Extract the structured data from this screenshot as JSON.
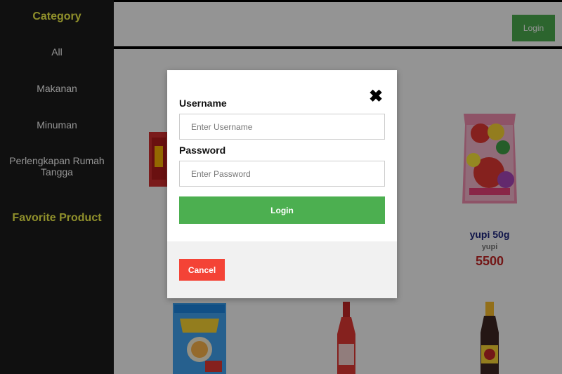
{
  "sidebar": {
    "category_title": "Category",
    "items": [
      {
        "label": "All"
      },
      {
        "label": "Makanan"
      },
      {
        "label": "Minuman"
      },
      {
        "label": "Perlengkapan Rumah Tangga"
      }
    ],
    "favorite_title": "Favorite Product"
  },
  "header": {
    "login_label": "Login"
  },
  "products": [
    {
      "name": "yupi 50g",
      "brand": "yupi",
      "price": "5500"
    }
  ],
  "modal": {
    "username_label": "Username",
    "username_placeholder": "Enter Username",
    "password_label": "Password",
    "password_placeholder": "Enter Password",
    "submit_label": "Login",
    "cancel_label": "Cancel",
    "close_glyph": "✖"
  },
  "colors": {
    "sidebar_bg": "#1c1c1c",
    "sidebar_title": "#f6f64a",
    "accent_green": "#4caf50",
    "cancel_red": "#f44336",
    "price_red": "#c62828",
    "product_name": "#1a237e"
  }
}
